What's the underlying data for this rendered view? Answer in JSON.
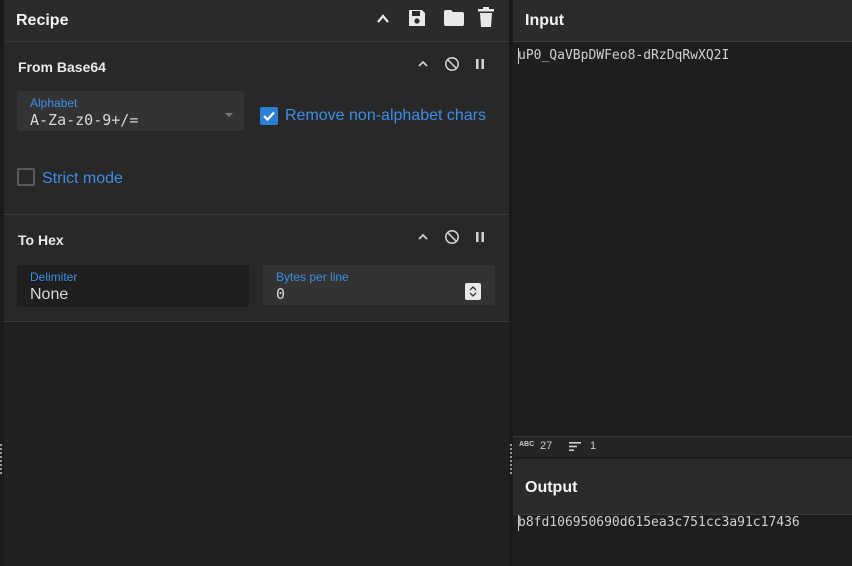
{
  "recipe": {
    "title": "Recipe",
    "operations": [
      {
        "title": "From Base64",
        "alphabet": {
          "label": "Alphabet",
          "value": "A-Za-z0-9+/="
        },
        "remove_non_alphabet": {
          "label": "Remove non-alphabet chars",
          "checked": true
        },
        "strict_mode": {
          "label": "Strict mode",
          "checked": false
        }
      },
      {
        "title": "To Hex",
        "delimiter": {
          "label": "Delimiter",
          "value": "None"
        },
        "bytes_per_line": {
          "label": "Bytes per line",
          "value": "0"
        }
      }
    ]
  },
  "input": {
    "title": "Input",
    "text": "uP0_QaVBpDWFeo8-dRzDqRwXQ2I",
    "status": {
      "length": "27",
      "lines": "1"
    }
  },
  "output": {
    "title": "Output",
    "text": "b8fd106950690d615ea3c751cc3a91c17436"
  },
  "colors": {
    "accent": "#3d8ee6",
    "checkbox": "#2d7fd3"
  }
}
